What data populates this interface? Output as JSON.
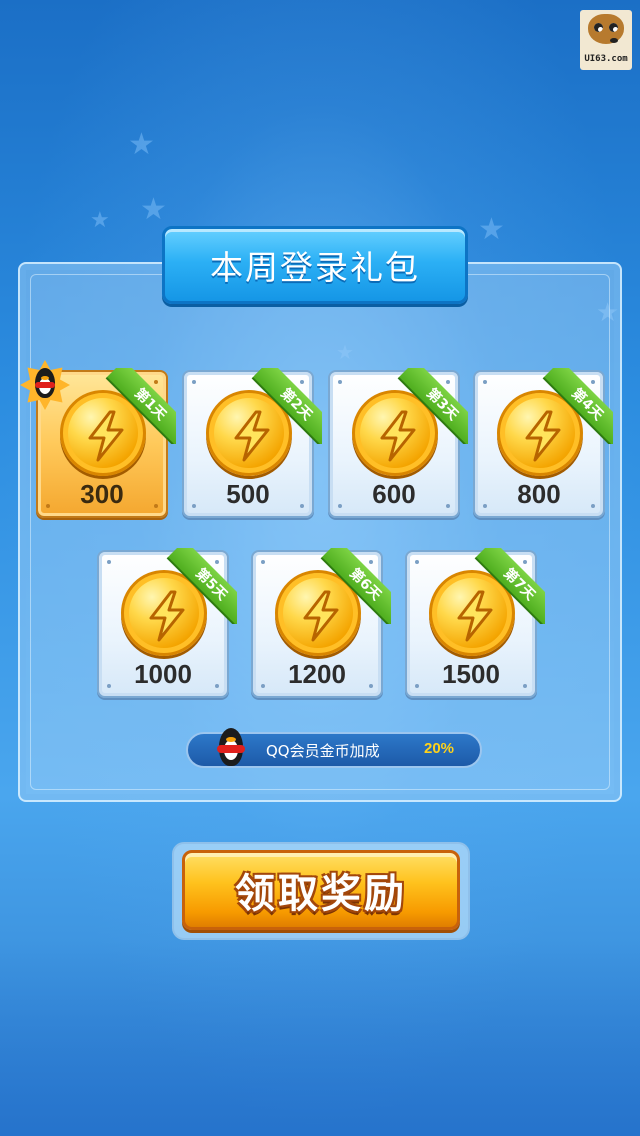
{
  "logo": {
    "text": "UI63.com"
  },
  "title": "本周登录礼包",
  "days": [
    {
      "label": "第1天",
      "amount": "300",
      "claimed_today": true
    },
    {
      "label": "第2天",
      "amount": "500",
      "claimed_today": false
    },
    {
      "label": "第3天",
      "amount": "600",
      "claimed_today": false
    },
    {
      "label": "第4天",
      "amount": "800",
      "claimed_today": false
    },
    {
      "label": "第5天",
      "amount": "1000",
      "claimed_today": false
    },
    {
      "label": "第6天",
      "amount": "1200",
      "claimed_today": false
    },
    {
      "label": "第7天",
      "amount": "1500",
      "claimed_today": false
    }
  ],
  "bonus": {
    "label": "QQ会员金币加成",
    "value": "20%"
  },
  "claim_button": {
    "label": "领取奖励"
  },
  "colors": {
    "accent_gold": "#ffc21d",
    "ribbon_green": "#4fae1f",
    "title_blue": "#2cb0f5",
    "bonus_yellow": "#ffd21a"
  },
  "icons": [
    "coin-lightning-icon",
    "qq-penguin-icon",
    "star-badge-icon"
  ]
}
